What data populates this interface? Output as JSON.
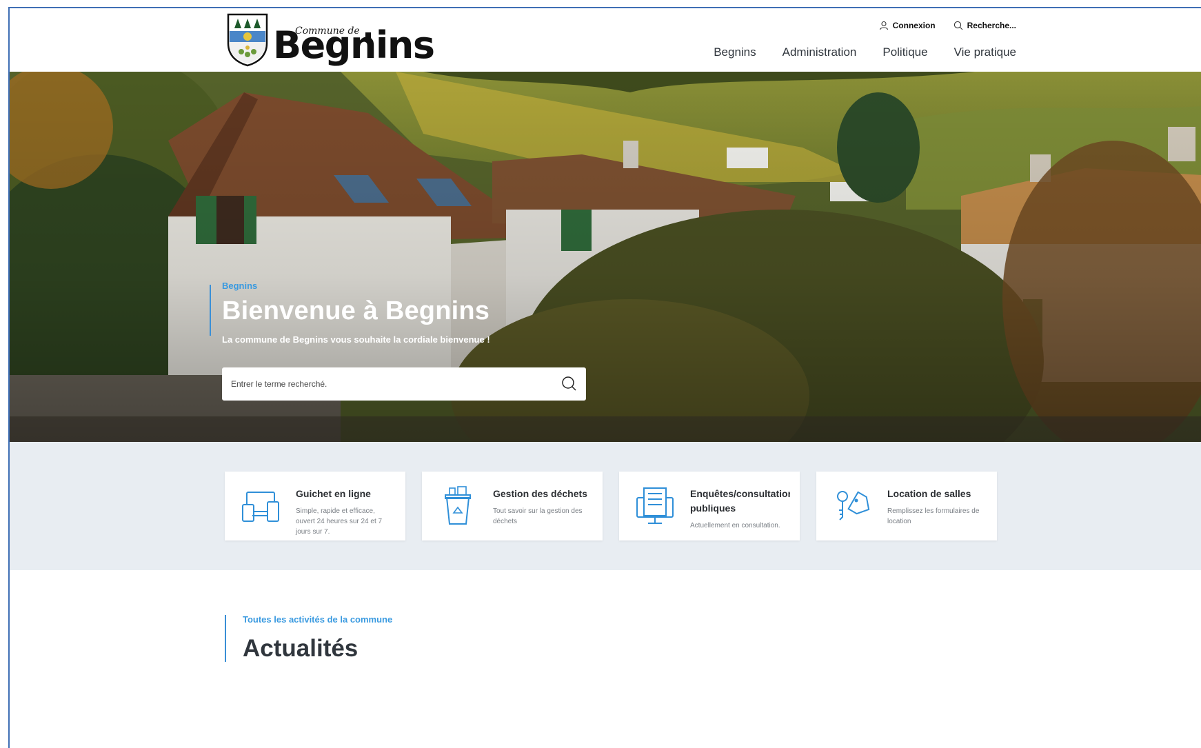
{
  "header": {
    "logo": {
      "small_text": "Commune de",
      "big_text": "Begnins"
    },
    "utility": [
      {
        "label": "Connexion",
        "icon": "user-icon"
      },
      {
        "label": "Recherche...",
        "icon": "search-icon"
      }
    ],
    "nav": [
      "Begnins",
      "Administration",
      "Politique",
      "Vie pratique"
    ]
  },
  "hero": {
    "kicker": "Begnins",
    "title": "Bienvenue à Begnins",
    "subtitle": "La commune de Begnins vous souhaite la cordiale bienvenue !",
    "search_placeholder": "Entrer le terme recherché."
  },
  "services": [
    {
      "title": "Guichet en ligne",
      "desc": "Simple, rapide et efficace, ouvert 24 heures sur 24 et 7 jours sur 7.",
      "icon": "devices-icon"
    },
    {
      "title": "Gestion des déchets",
      "desc": "Tout savoir sur la gestion des déchets",
      "icon": "recycling-bin-icon"
    },
    {
      "title": "Enquêtes/consultations publiques",
      "desc": "Actuellement en consultation.",
      "icon": "monitor-document-icon"
    },
    {
      "title": "Location de salles",
      "desc": "Remplissez les formulaires de location",
      "icon": "keys-icon"
    }
  ],
  "news": {
    "kicker": "Toutes les activités de la commune",
    "title": "Actualités"
  },
  "colors": {
    "accent": "#3a9ae0",
    "services_bg": "#e8edf2",
    "icon_blue": "#2f8fd8"
  }
}
